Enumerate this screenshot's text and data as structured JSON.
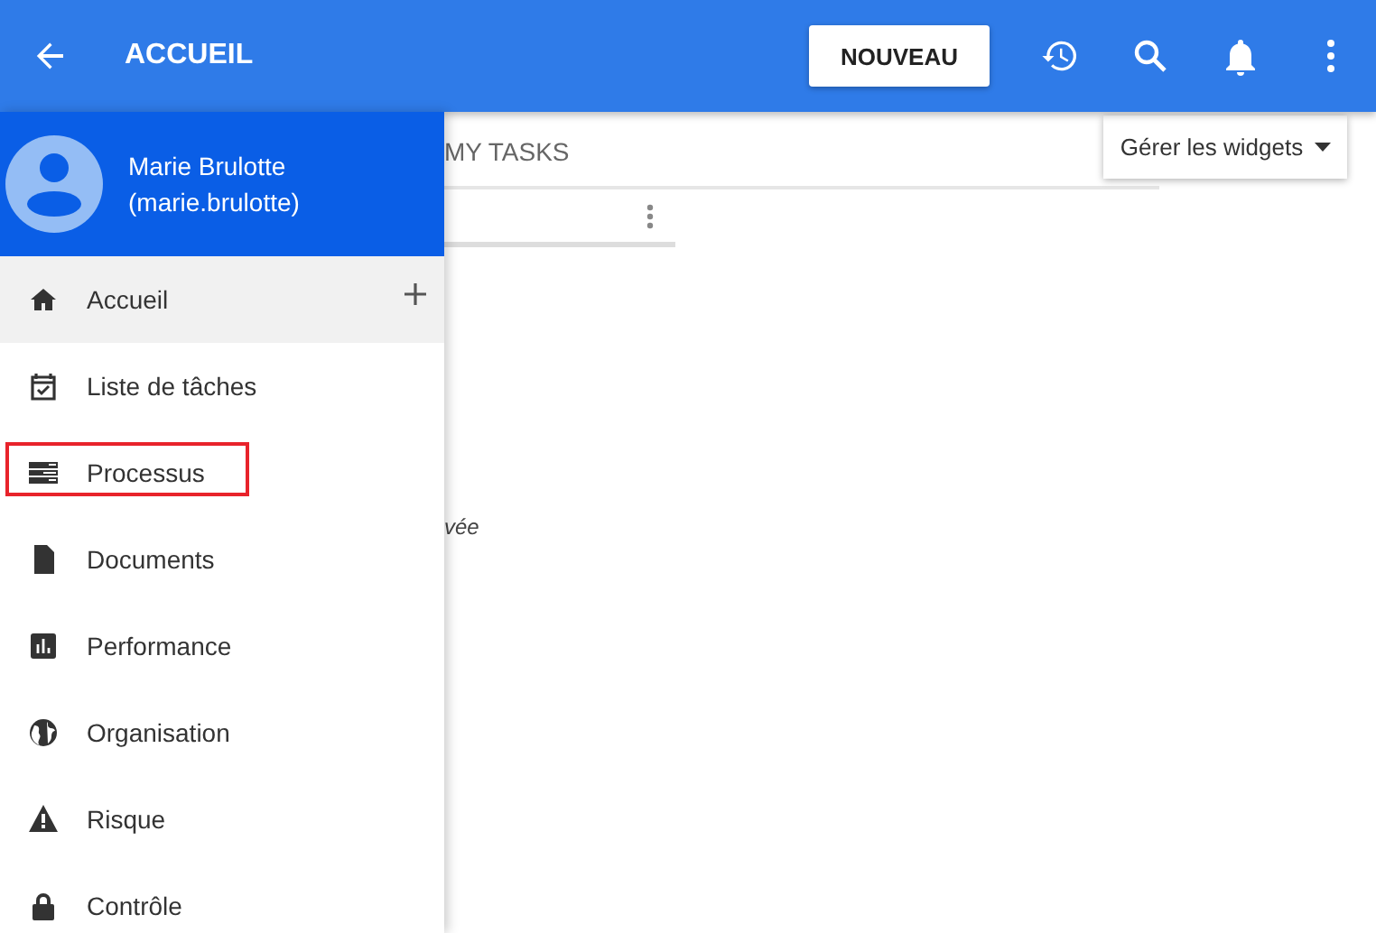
{
  "header": {
    "title": "ACCUEIL",
    "new_button": "NOUVEAU"
  },
  "content": {
    "tab": "MY TASKS",
    "manage_button": "Gérer les widgets",
    "partial_text": "vée"
  },
  "drawer": {
    "user_name": "Marie Brulotte",
    "user_login": "(marie.brulotte)",
    "items": [
      {
        "label": "Accueil",
        "selected": true,
        "highlighted": false
      },
      {
        "label": "Liste de tâches",
        "selected": false,
        "highlighted": false
      },
      {
        "label": "Processus",
        "selected": false,
        "highlighted": true
      },
      {
        "label": "Documents",
        "selected": false,
        "highlighted": false
      },
      {
        "label": "Performance",
        "selected": false,
        "highlighted": false
      },
      {
        "label": "Organisation",
        "selected": false,
        "highlighted": false
      },
      {
        "label": "Risque",
        "selected": false,
        "highlighted": false
      },
      {
        "label": "Contrôle",
        "selected": false,
        "highlighted": false
      }
    ]
  }
}
